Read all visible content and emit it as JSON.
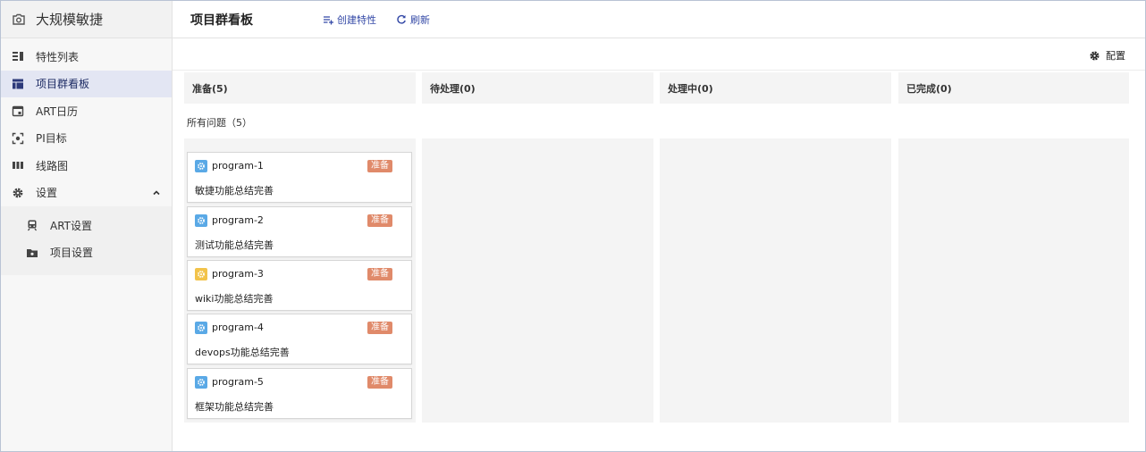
{
  "brand": {
    "name": "大规模敏捷"
  },
  "sidebar": {
    "items": [
      {
        "label": "特性列表",
        "icon": "list-icon"
      },
      {
        "label": "项目群看板",
        "icon": "board-icon",
        "active": true
      },
      {
        "label": "ART日历",
        "icon": "calendar-icon"
      },
      {
        "label": "PI目标",
        "icon": "target-icon"
      },
      {
        "label": "线路图",
        "icon": "roadmap-icon"
      },
      {
        "label": "设置",
        "icon": "gear-icon",
        "expanded": true
      }
    ],
    "subitems": [
      {
        "label": "ART设置",
        "icon": "train-icon"
      },
      {
        "label": "项目设置",
        "icon": "folder-icon"
      }
    ]
  },
  "header": {
    "title": "项目群看板",
    "create_label": "创建特性",
    "refresh_label": "刷新"
  },
  "toolbar": {
    "config_label": "配置"
  },
  "board": {
    "columns": [
      {
        "label": "准备(5)"
      },
      {
        "label": "待处理(0)"
      },
      {
        "label": "处理中(0)"
      },
      {
        "label": "已完成(0)"
      }
    ],
    "group_label": "所有问题（5）",
    "cards": [
      {
        "key": "program-1",
        "summary": "敏捷功能总结完善",
        "status": "准备",
        "type_color": "#5aa9e6"
      },
      {
        "key": "program-2",
        "summary": "测试功能总结完善",
        "status": "准备",
        "type_color": "#5aa9e6"
      },
      {
        "key": "program-3",
        "summary": "wiki功能总结完善",
        "status": "准备",
        "type_color": "#f2c34a"
      },
      {
        "key": "program-4",
        "summary": "devops功能总结完善",
        "status": "准备",
        "type_color": "#5aa9e6"
      },
      {
        "key": "program-5",
        "summary": "框架功能总结完善",
        "status": "准备",
        "type_color": "#5aa9e6"
      }
    ]
  },
  "colors": {
    "accent": "#3348a6",
    "status_tag": "#e08a6a",
    "active_nav": "#e3e6f3"
  }
}
